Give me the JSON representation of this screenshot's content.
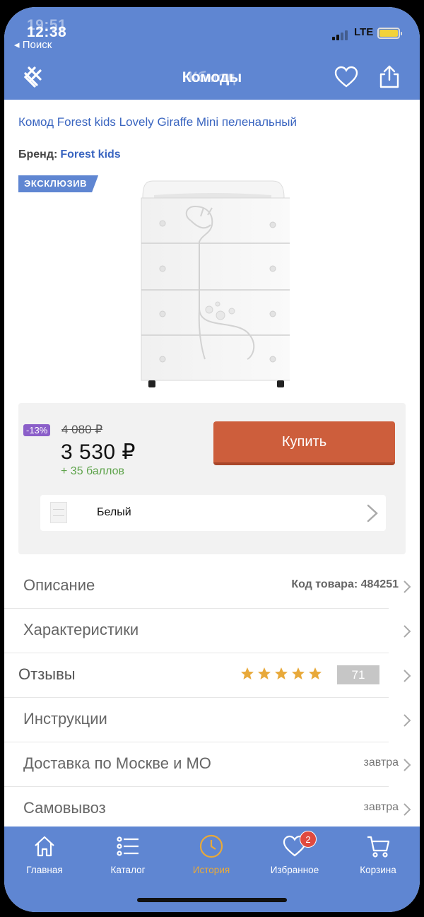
{
  "status_bar": {
    "time": "12:38",
    "time_ghost": "19:51",
    "back_label": "◂ Поиск",
    "network": "LTE"
  },
  "header": {
    "title": "Комоды",
    "title_ghost": "Кбмод",
    "logo_icon": "logo-icon",
    "favorite_icon": "heart-icon",
    "share_icon": "share-icon"
  },
  "product": {
    "name": "Комод Forest kids Lovely Giraffe Mini пеленальный",
    "brand_label": "Бренд:",
    "brand_value": "Forest kids",
    "badge": "ЭКСКЛЮЗИВ"
  },
  "buy": {
    "discount": "-13%",
    "old_price": "4 080 ₽",
    "price": "3 530 ₽",
    "bonus": "+ 35 баллов",
    "buy_label": "Купить",
    "color_label": "Белый"
  },
  "rows": {
    "description": {
      "label": "Описание",
      "right": "Код товара: 484251"
    },
    "specs": {
      "label": "Характеристики"
    },
    "reviews": {
      "label": "Отзывы",
      "rating": 5,
      "count": "71"
    },
    "instructions": {
      "label": "Инструкции"
    },
    "delivery": {
      "label": "Доставка по Москве и МО",
      "right": "завтра"
    },
    "pickup": {
      "label": "Самовывоз",
      "right": "завтра"
    }
  },
  "tabbar": {
    "home": "Главная",
    "catalog": "Каталог",
    "history": "История",
    "favorites": "Избранное",
    "favorites_badge": "2",
    "cart": "Корзина"
  },
  "colors": {
    "brand_blue": "#5f86d2",
    "buy_orange": "#cd5e3c",
    "star_gold": "#e8a93a",
    "bonus_green": "#5da34a",
    "discount_purple": "#8b5fc9"
  }
}
